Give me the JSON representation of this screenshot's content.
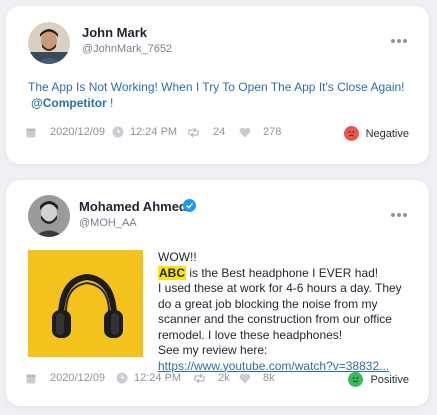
{
  "posts": [
    {
      "author": "John Mark",
      "handle": "@JohnMark_7652",
      "text": "The App Is Not Working! When I Try To Open The App It's Close Again!",
      "mention": "@Competitor",
      "mention_suffix": " !",
      "date": "2020/12/09",
      "time": "12:24 PM",
      "retweets": "24",
      "likes": "278",
      "sentiment": "Negative",
      "sentiment_color": "#e8564f",
      "verified": false
    },
    {
      "author": "Mohamed Ahmed",
      "handle": "@MOH_AA",
      "verified": true,
      "verified_color": "#1d9bf0",
      "line1": "WOW!!",
      "highlight": "ABC",
      "line2_rest": " is the Best headphone I EVER had!",
      "line3": "I used these at work for 4-6 hours a day. They do a great job blocking the noise from my scanner and the construction from our office remodel. I love these headphones!",
      "review_prefix": "See my review here: ",
      "review_link": "https://www.youtube.com/watch?v=38832...",
      "date": "2020/12/09",
      "time": "12:24 PM",
      "retweets": "2k",
      "likes": "8k",
      "sentiment": "Positive",
      "sentiment_color": "#3bb85a",
      "image_bg": "#f4c21d",
      "image_icon": "headphones-image"
    }
  ]
}
